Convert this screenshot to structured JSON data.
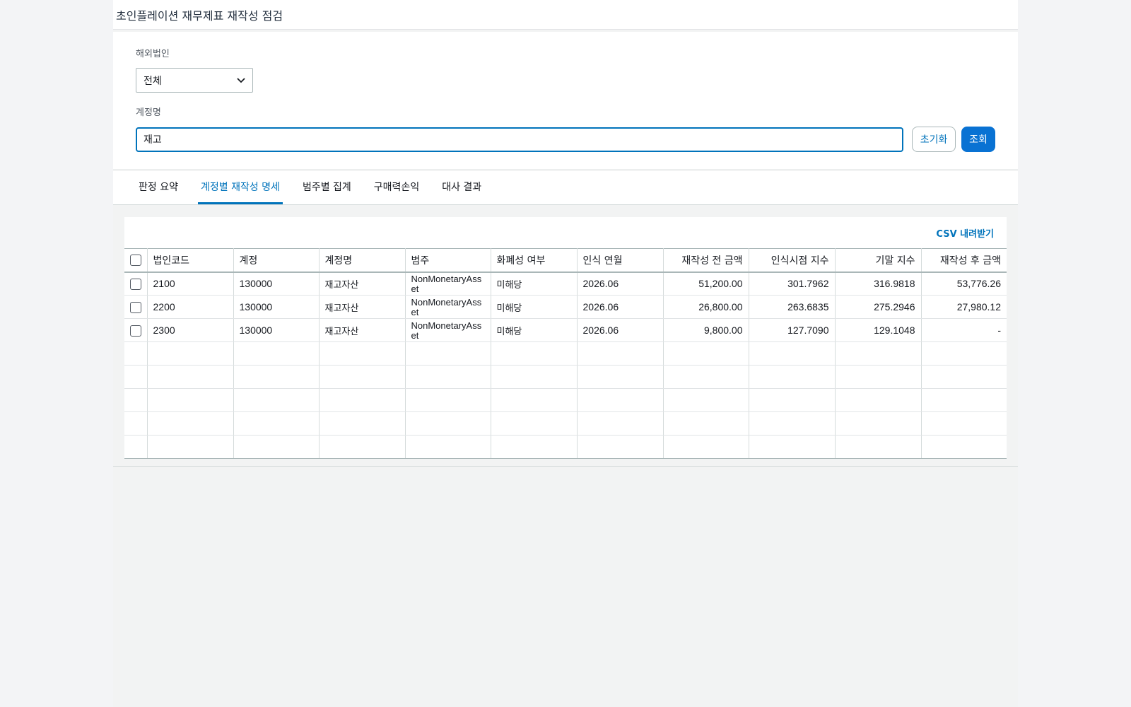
{
  "header": {
    "title": "초인플레이션 재무제표 재작성 점검"
  },
  "filters": {
    "entity_label": "해외법인",
    "entity_value": "전체",
    "account_label": "계정명",
    "account_value": "재고",
    "reset_label": "초기화",
    "search_label": "조회"
  },
  "tabs": [
    {
      "label": "판정 요약"
    },
    {
      "label": "계정별 재작성 명세"
    },
    {
      "label": "범주별 집계"
    },
    {
      "label": "구매력손익"
    },
    {
      "label": "대사 결과"
    }
  ],
  "table": {
    "csv_label": "CSV 내려받기",
    "columns": [
      "법인코드",
      "계정",
      "계정명",
      "범주",
      "화폐성 여부",
      "인식 연월",
      "재작성 전 금액",
      "인식시점 지수",
      "기말 지수",
      "재작성 후 금액"
    ],
    "rows": [
      [
        "2100",
        "130000",
        "재고자산",
        "NonMonetaryAsset",
        "미해당",
        "2026.06",
        "51,200.00",
        "301.7962",
        "316.9818",
        "53,776.26"
      ],
      [
        "2200",
        "130000",
        "재고자산",
        "NonMonetaryAsset",
        "미해당",
        "2026.06",
        "26,800.00",
        "263.6835",
        "275.2946",
        "27,980.12"
      ],
      [
        "2300",
        "130000",
        "재고자산",
        "NonMonetaryAsset",
        "미해당",
        "2026.06",
        "9,800.00",
        "127.7090",
        "129.1048",
        "-"
      ]
    ]
  }
}
